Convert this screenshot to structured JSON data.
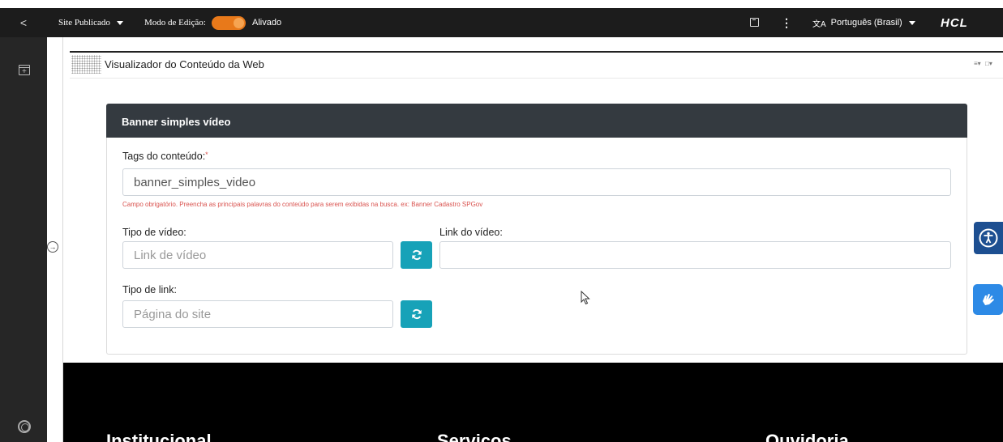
{
  "topbar": {
    "back_glyph": "<",
    "site_menu": "Site Publicado",
    "edit_mode_label": "Modo de Edição:",
    "edit_mode_state": "Alivado",
    "edit_mode_on": true,
    "language": "Português (Brasil)",
    "language_glyph": "文A",
    "brand": "HCL",
    "toggle_color": "#e8791a"
  },
  "portlet": {
    "title": "Visualizador do Conteúdo da Web",
    "controls": [
      "≡▾",
      "□▾"
    ]
  },
  "form": {
    "header": "Banner simples vídeo",
    "tags_label": "Tags do conteúdo:",
    "tags_required": "*",
    "tags_value": "banner_simples_video",
    "tags_error": "Campo obrigatório. Preencha as principais palavras do conteúdo para serem exibidas na busca. ex: Banner Cadastro SPGov",
    "video_type_label": "Tipo de vídeo:",
    "video_type_value": "Link de vídeo",
    "video_link_label": "Link do vídeo:",
    "video_link_value": "",
    "link_type_label": "Tipo de link:",
    "link_type_value": "Página do site",
    "accent_color": "#17a2b8",
    "header_color": "#343a40",
    "error_color": "#d9534f"
  },
  "footer": {
    "columns": [
      "Institucional",
      "Serviços",
      "Ouvidoria"
    ]
  },
  "icons": [
    "chevron-left-icon",
    "caret-down-icon",
    "toggle-switch",
    "panel-icon",
    "kebab-icon",
    "translate-icon",
    "add-page-icon",
    "expand-arrow-icon",
    "help-lifebuoy-icon",
    "refresh-icon",
    "accessibility-icon",
    "sign-language-icon",
    "mouse-cursor-icon"
  ]
}
